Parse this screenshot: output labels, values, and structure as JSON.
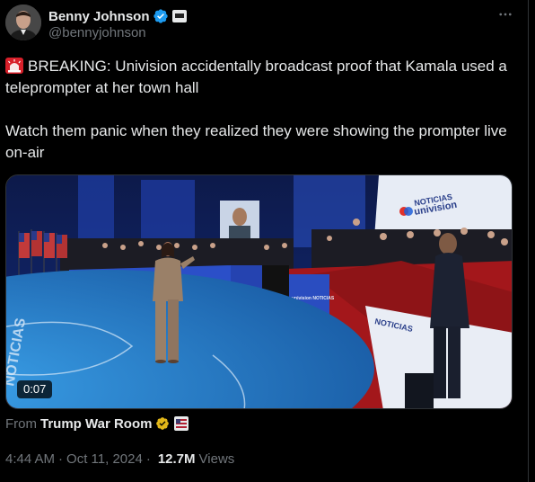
{
  "author": {
    "display_name": "Benny Johnson",
    "handle": "@bennyjohnson",
    "verified": true,
    "avatar_icon": "user-avatar-photo"
  },
  "tweet": {
    "line1": "BREAKING: Univision accidentally broadcast proof that Kamala used a teleprompter at her town hall",
    "line2": "Watch them panic when they realized they were showing the prompter live on-air",
    "siren_icon": "police-light-icon"
  },
  "media": {
    "duration": "0:07",
    "screen_banner_line1": "NOTICIAS",
    "screen_banner_line2": "univision",
    "stage_sign": "NOTICIAS univision",
    "podium_label": "univision NOTICIAS"
  },
  "source": {
    "from_label": "From",
    "account_name": "Trump War Room"
  },
  "meta": {
    "time": "4:44 AM",
    "separator": "·",
    "date": "Oct 11, 2024",
    "views_count": "12.7M",
    "views_label": "Views"
  },
  "colors": {
    "background": "#000000",
    "text_primary": "#e7e9ea",
    "text_secondary": "#71767b",
    "verified_blue": "#1d9bf0",
    "verified_gold": "#e2b719",
    "stage_red": "#b3181c",
    "floor_blue": "#2b8ed6"
  }
}
